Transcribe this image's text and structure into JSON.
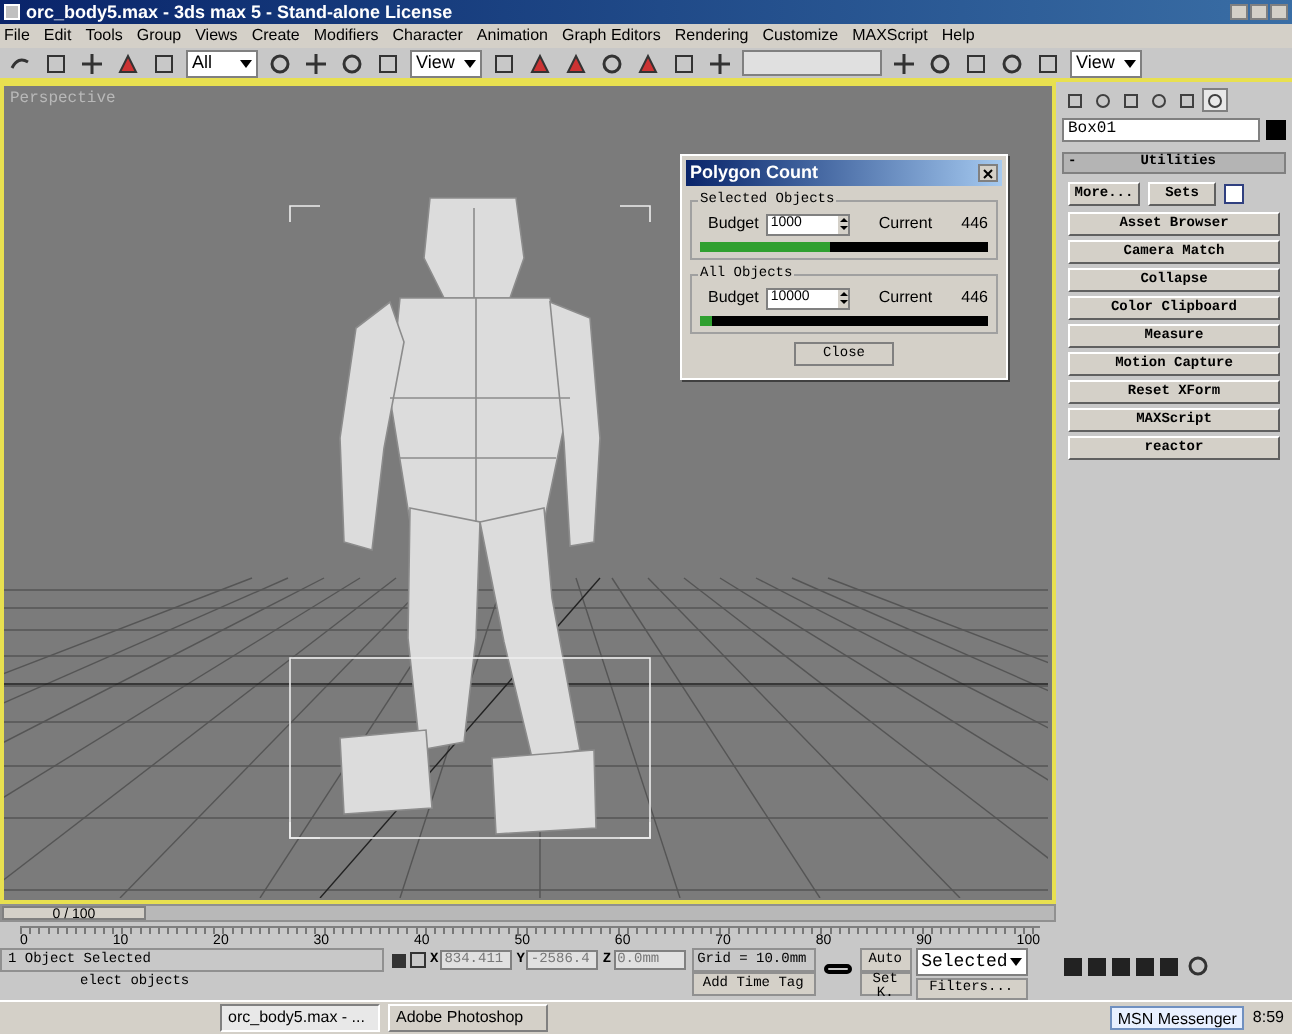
{
  "window": {
    "title": "orc_body5.max - 3ds max 5 - Stand-alone License"
  },
  "menu": [
    "File",
    "Edit",
    "Tools",
    "Group",
    "Views",
    "Create",
    "Modifiers",
    "Character",
    "Animation",
    "Graph Editors",
    "Rendering",
    "Customize",
    "MAXScript",
    "Help"
  ],
  "toolbar": {
    "selection_filter": "All",
    "reference_coord": "View",
    "viewport_dropdown": "View"
  },
  "viewport": {
    "label": "Perspective",
    "active": true
  },
  "dialog": {
    "title": "Polygon Count",
    "groups": [
      {
        "title": "Selected Objects",
        "budget_label": "Budget",
        "budget": "1000",
        "current_label": "Current",
        "current": "446",
        "level": 0.45
      },
      {
        "title": "All Objects",
        "budget_label": "Budget",
        "budget": "10000",
        "current_label": "Current",
        "current": "446",
        "level": 0.045
      }
    ],
    "close": "Close"
  },
  "command_panel": {
    "tabs": [
      {
        "selected": false
      },
      {
        "selected": false
      },
      {
        "selected": false
      },
      {
        "selected": false
      },
      {
        "selected": false
      },
      {
        "selected": true
      }
    ],
    "object_name": "Box01",
    "rollout_sign": "-",
    "rollout_title": "Utilities",
    "more": "More...",
    "sets": "Sets",
    "utilities": [
      "Asset Browser",
      "Camera Match",
      "Collapse",
      "Color Clipboard",
      "Measure",
      "Motion Capture",
      "Reset XForm",
      "MAXScript",
      "reactor"
    ]
  },
  "timeline": {
    "position": "0 / 100",
    "level": 0,
    "ticks": [
      "0",
      "10",
      "20",
      "30",
      "40",
      "50",
      "60",
      "70",
      "80",
      "90",
      "100"
    ]
  },
  "status": {
    "selection": "1 Object Selected",
    "prompt": "elect objects",
    "coords": [
      {
        "axis": "X",
        "value": "834.411"
      },
      {
        "axis": "Y",
        "value": "-2586.4"
      },
      {
        "axis": "Z",
        "value": "0.0mm"
      }
    ],
    "grid": "Grid = 10.0mm",
    "add_time_tag": "Add Time Tag",
    "auto": "Auto",
    "set_key": "Set K.",
    "key_filter": "Selected",
    "filters": "Filters..."
  },
  "taskbar": {
    "tasks": [
      {
        "label": "orc_body5.max - ...",
        "selected": true
      },
      {
        "label": "Adobe Photoshop",
        "selected": false
      }
    ],
    "notification": "MSN Messenger",
    "clock": "8:59"
  }
}
